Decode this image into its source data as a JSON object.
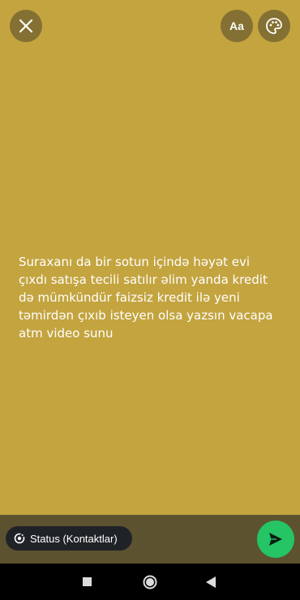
{
  "status_editor": {
    "background_color": "#c3a43f",
    "text": "Suraxanı da bir sotun içində həyət evi çıxdı satışa tecili satılır əlim yanda kredit də mümkündür faizsiz kredit ilə yeni təmirdən çıxıb isteyen olsa yazsın vacapa atm video sunu"
  },
  "toolbar": {
    "close_icon": "close-icon",
    "font_label": "Aa",
    "palette_icon": "palette-icon"
  },
  "bottom_bar": {
    "audience_label": "Status (Kontaktlar)",
    "audience_icon": "status-ring-icon",
    "send_icon": "send-icon",
    "send_color": "#25c464"
  },
  "nav": {
    "recents_icon": "square-recents-icon",
    "home_icon": "circle-home-icon",
    "back_icon": "triangle-back-icon"
  }
}
